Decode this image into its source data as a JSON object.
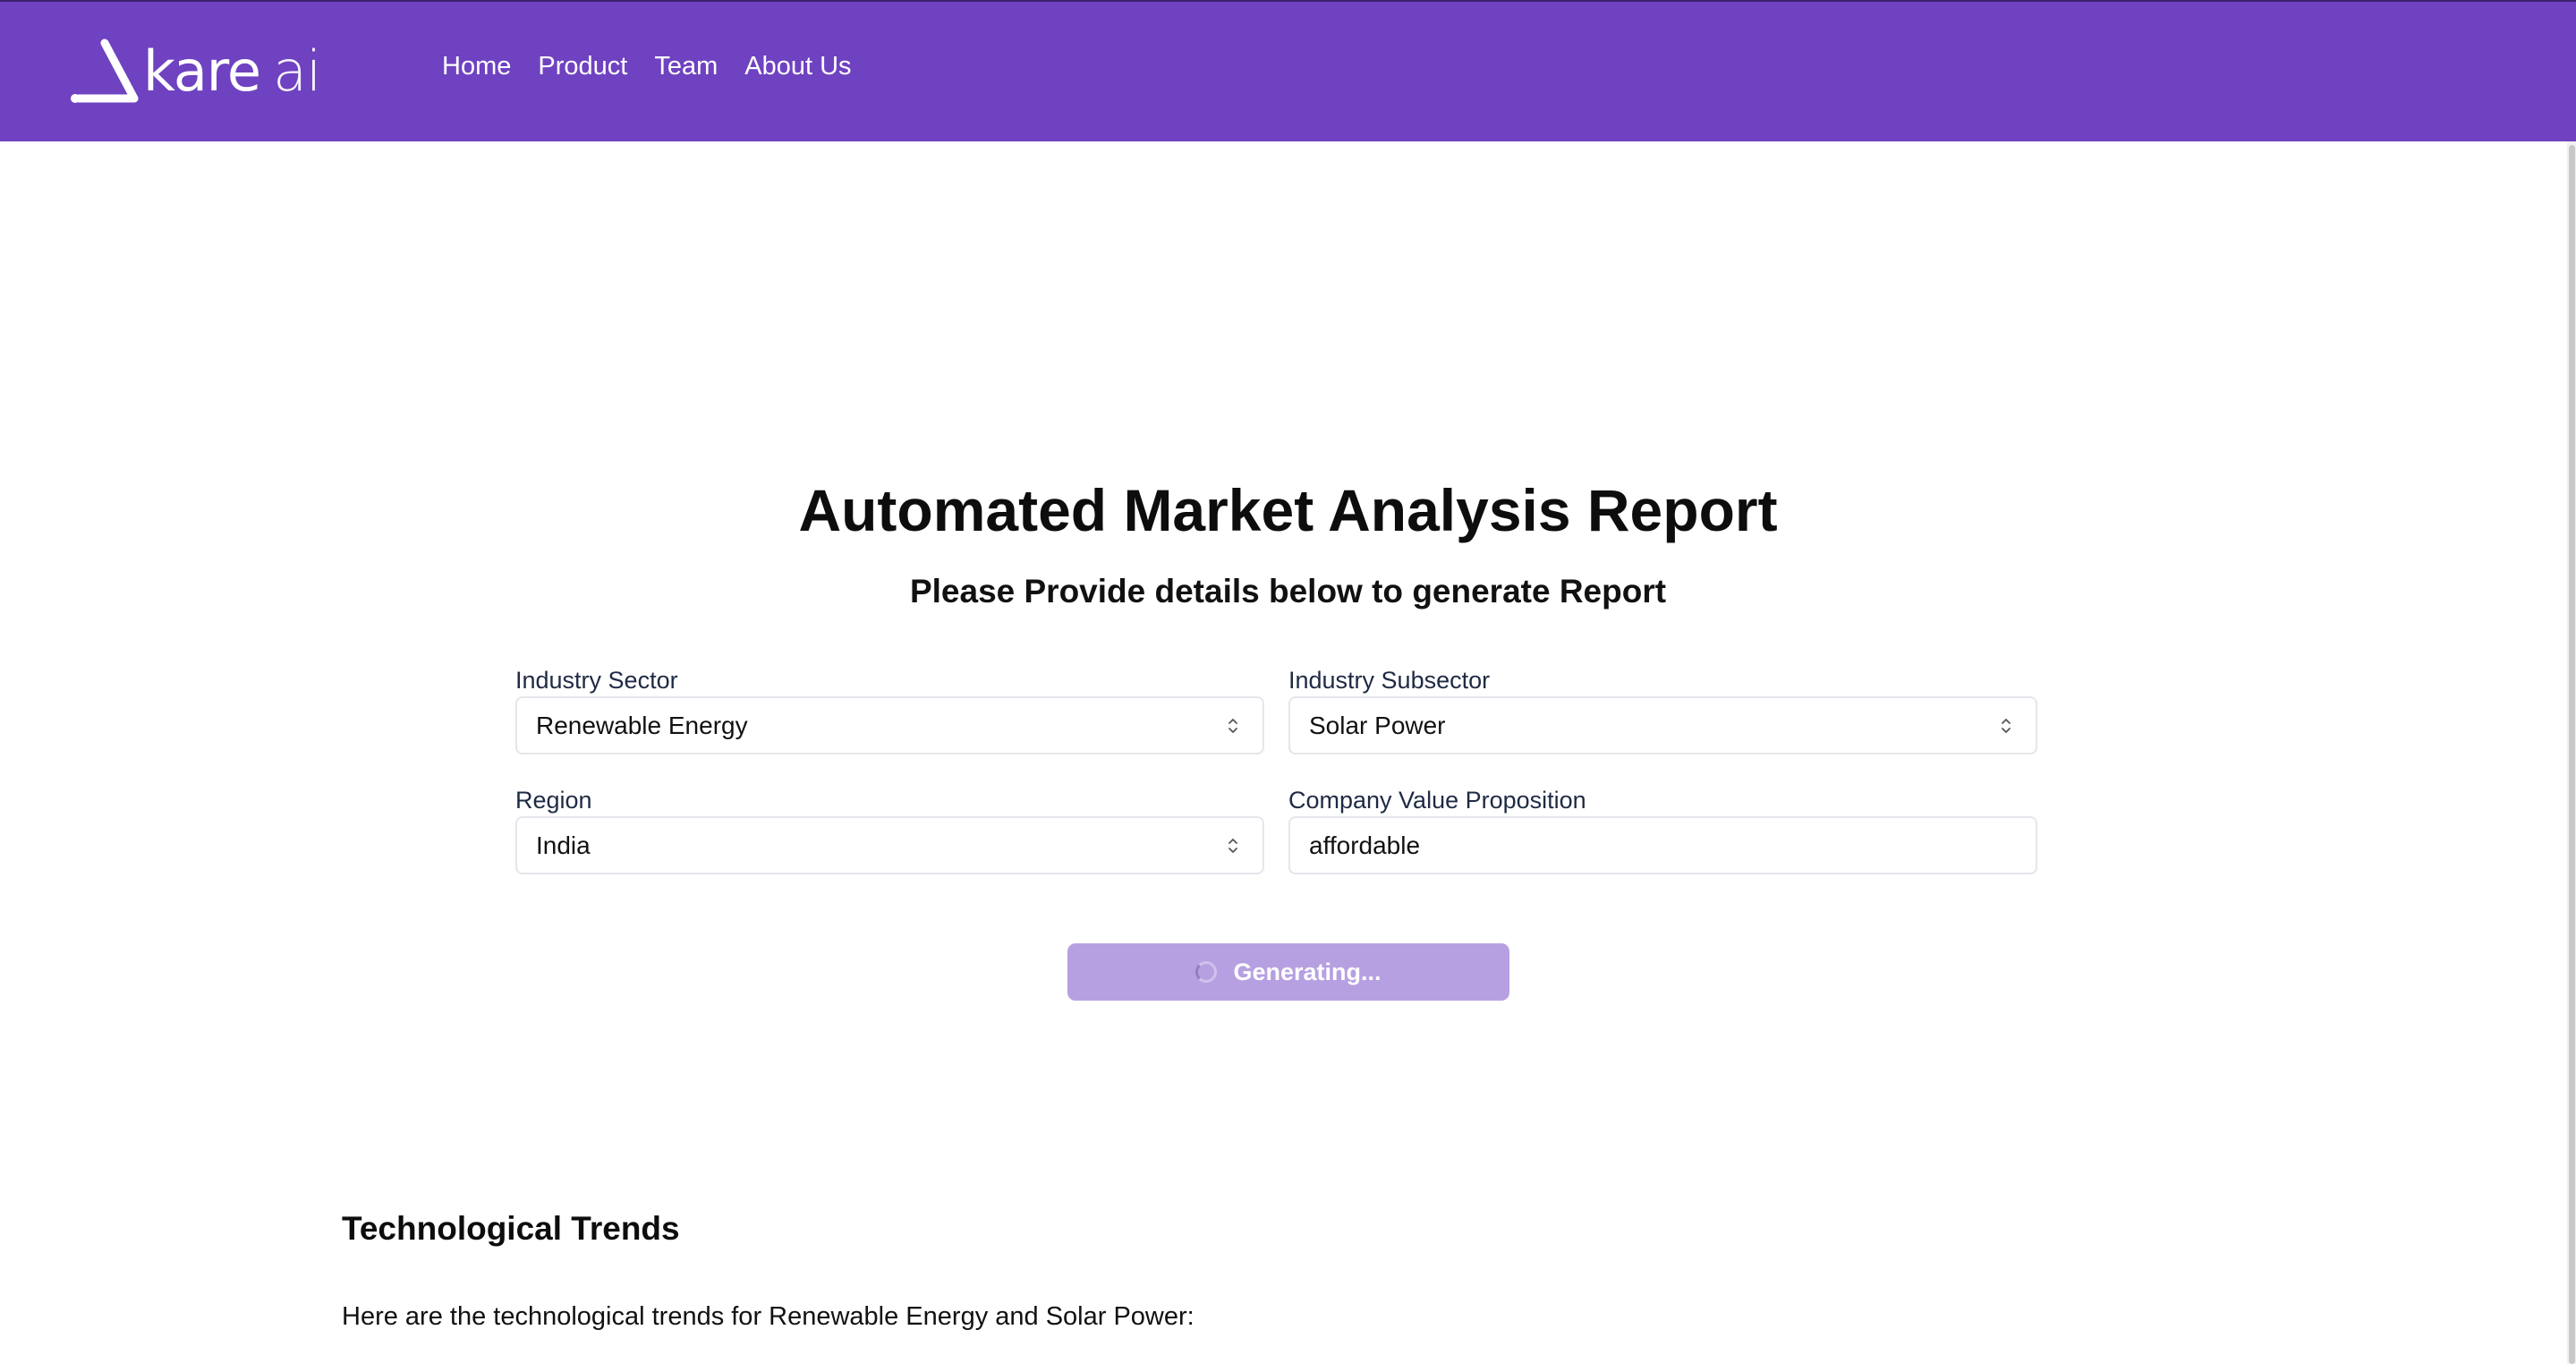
{
  "brand": {
    "name": "kare",
    "suffix": "ai",
    "color": "#6f42c1"
  },
  "nav": {
    "items": [
      {
        "label": "Home"
      },
      {
        "label": "Product"
      },
      {
        "label": "Team"
      },
      {
        "label": "About Us"
      }
    ]
  },
  "main": {
    "title": "Automated Market Analysis Report",
    "subtitle": "Please Provide details below to generate Report"
  },
  "form": {
    "industry_sector": {
      "label": "Industry Sector",
      "value": "Renewable Energy"
    },
    "industry_subsector": {
      "label": "Industry Subsector",
      "value": "Solar Power"
    },
    "region": {
      "label": "Region",
      "value": "India"
    },
    "value_proposition": {
      "label": "Company Value Proposition",
      "value": "affordable"
    },
    "submit": {
      "label": "Generating...",
      "state": "loading",
      "color": "#b6a0e1"
    }
  },
  "report": {
    "section_title": "Technological Trends",
    "intro": "Here are the technological trends for Renewable Energy and Solar Power:"
  }
}
